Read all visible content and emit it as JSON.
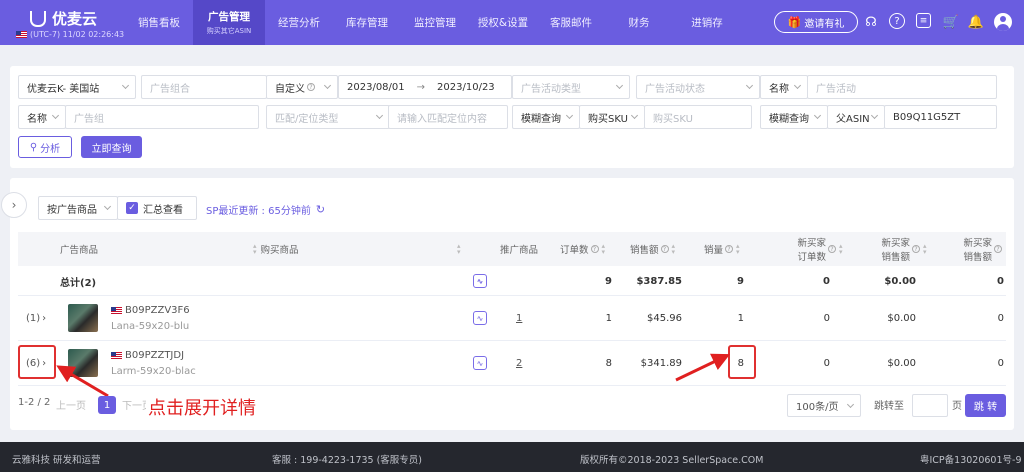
{
  "app": {
    "logo_text": "优麦云",
    "timezone": "(UTC-7) 11/02 02:26:43"
  },
  "nav": [
    {
      "label": "销售看板"
    },
    {
      "label": "广告管理",
      "sub": "购买其它ASIN"
    },
    {
      "label": "经营分析"
    },
    {
      "label": "库存管理"
    },
    {
      "label": "监控管理"
    },
    {
      "label": "授权&设置"
    },
    {
      "label": "客服邮件"
    },
    {
      "label": "财务"
    },
    {
      "label": "进销存"
    }
  ],
  "header": {
    "invite_label": "邀请有礼",
    "icons": [
      "headset-icon",
      "help-icon",
      "message-icon",
      "cart-icon",
      "bell-icon",
      "user-avatar"
    ]
  },
  "filters": {
    "store": "优麦云K- 美国站",
    "ad_group_combo_ph": "广告组合",
    "date_mode": "自定义",
    "date_start": "2023/08/01",
    "date_sep": "→",
    "date_end": "2023/10/23",
    "campaign_type_ph": "广告活动类型",
    "campaign_status_ph": "广告活动状态",
    "name_label_1": "名称",
    "campaign_ph": "广告活动",
    "name_label_2": "名称",
    "ad_group_ph": "广告组",
    "match_type_ph": "匹配/定位类型",
    "match_content_ph": "请输入匹配定位内容",
    "fuzzy_label_1": "模糊查询",
    "buy_sku_select": "购买SKU",
    "buy_sku_ph": "购买SKU",
    "fuzzy_label_2": "模糊查询",
    "parent_asin_select": "父ASIN",
    "parent_asin_value": "B09Q11G5ZT",
    "analyze_btn": "分析",
    "query_btn": "立即查询"
  },
  "toolbar": {
    "group_by": "按广告商品",
    "summary_view": "汇总查看",
    "sp_update": "SP最近更新 : 65分钟前"
  },
  "table": {
    "headers": {
      "ad_product": "广告商品",
      "buy_product": "购买商品",
      "promo_product": "推广商品",
      "orders": "订单数",
      "sales": "销售额",
      "volume": "销量",
      "new_buyer_orders_1": "新买家",
      "new_buyer_orders_2": "订单数",
      "new_buyer_sales_1": "新买家",
      "new_buyer_sales_2": "销售额",
      "new_buyer_sales3_1": "新买家",
      "new_buyer_sales3_2": "销售额"
    },
    "total": {
      "label": "总计(2)",
      "orders": "9",
      "sales": "$387.85",
      "volume": "9",
      "nb_orders": "0",
      "nb_sales": "$0.00",
      "nb_sales2": "0"
    },
    "rows": [
      {
        "expander": "(1)",
        "asin": "B09PZZV3F6",
        "sku": "Lana-59x20-blu",
        "promo": "1",
        "orders": "1",
        "sales": "$45.96",
        "volume": "1",
        "nb_orders": "0",
        "nb_sales": "$0.00",
        "nb_sales2": "0"
      },
      {
        "expander": "(6)",
        "asin": "B09PZZTJDJ",
        "sku": "Larm-59x20-blac",
        "promo": "2",
        "orders": "8",
        "sales": "$341.89",
        "volume": "8",
        "nb_orders": "0",
        "nb_sales": "$0.00",
        "nb_sales2": "0"
      }
    ]
  },
  "pagination": {
    "range": "1-2 / 2",
    "prev": "上一页",
    "current": "1",
    "next": "下一页",
    "page_size": "100条/页",
    "jump_label": "跳转至",
    "page_unit": "页",
    "jump_btn": "跳 转"
  },
  "annotation": {
    "callout": "点击展开详情"
  },
  "footer": {
    "company": "云雅科技 研发和运营",
    "service": "客服 : 199-4223-1735 (客服专员)",
    "copyright": "版权所有©2018-2023 SellerSpace.COM",
    "icp": "粤ICP备13020601号-9"
  }
}
